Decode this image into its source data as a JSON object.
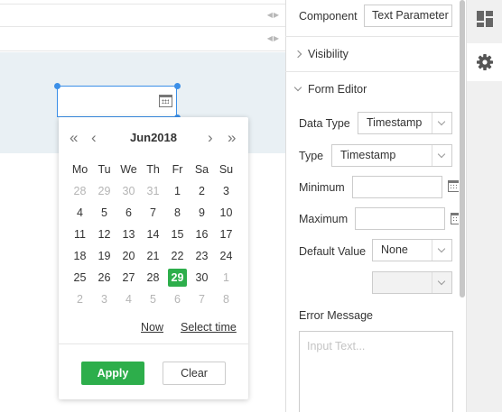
{
  "calendar": {
    "month_title": "Jun2018",
    "nav": {
      "prev_year": "«",
      "prev_month": "‹",
      "next_month": "›",
      "next_year": "»"
    },
    "weekdays": [
      "Mo",
      "Tu",
      "We",
      "Th",
      "Fr",
      "Sa",
      "Su"
    ],
    "weeks": [
      [
        "28",
        "29",
        "30",
        "31",
        "1",
        "2",
        "3"
      ],
      [
        "4",
        "5",
        "6",
        "7",
        "8",
        "9",
        "10"
      ],
      [
        "11",
        "12",
        "13",
        "14",
        "15",
        "16",
        "17"
      ],
      [
        "18",
        "19",
        "20",
        "21",
        "22",
        "23",
        "24"
      ],
      [
        "25",
        "26",
        "27",
        "28",
        "29",
        "30",
        "1"
      ],
      [
        "2",
        "3",
        "4",
        "5",
        "6",
        "7",
        "8"
      ]
    ],
    "selected_day": "29",
    "now_link": "Now",
    "select_time_link": "Select time",
    "apply_label": "Apply",
    "clear_label": "Clear"
  },
  "panel": {
    "component_label": "Component",
    "component_value": "Text Parameter",
    "visibility_title": "Visibility",
    "form_editor_title": "Form Editor",
    "data_type_label": "Data Type",
    "data_type_value": "Timestamp",
    "type_label": "Type",
    "type_value": "Timestamp",
    "minimum_label": "Minimum",
    "minimum_value": "",
    "maximum_label": "Maximum",
    "maximum_value": "",
    "default_value_label": "Default Value",
    "default_value_value": "None",
    "default_value_extra": "",
    "error_message_label": "Error Message",
    "error_message_placeholder": "Input Text..."
  },
  "colors": {
    "accent_green": "#2dae4b",
    "selection_blue": "#3b8fe8",
    "canvas_band": "#e9f0f4"
  },
  "icons": {
    "rail_top": "dashboard-layout-icon",
    "rail_bottom": "gear-icon"
  }
}
